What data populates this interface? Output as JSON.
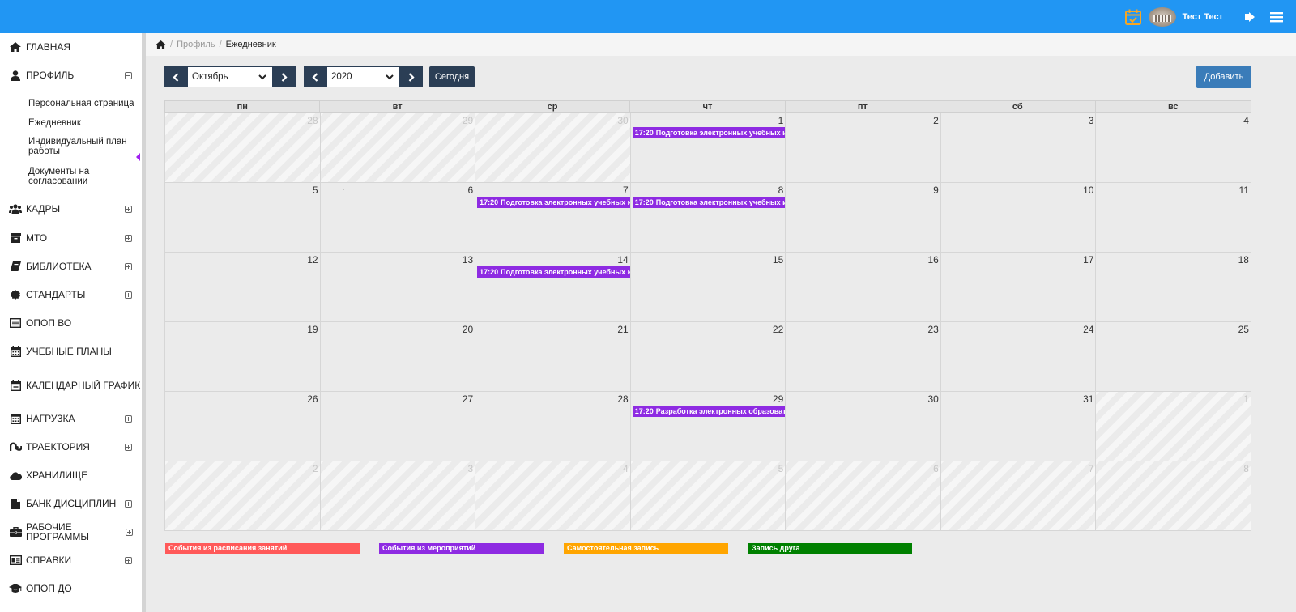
{
  "header": {
    "user_name": "Тест Тест",
    "bar_color": "#2196f3",
    "icons": [
      "calendar-check-icon",
      "avatar",
      "logout-icon",
      "menu-icon"
    ]
  },
  "sidebar": {
    "items": [
      {
        "label": "ГЛАВНАЯ",
        "icon": "home-icon",
        "expandable": false
      },
      {
        "label": "ПРОФИЛЬ",
        "icon": "user-icon",
        "expandable": true,
        "expanded": true
      },
      {
        "label": "КАДРЫ",
        "icon": "users-icon",
        "expandable": true
      },
      {
        "label": "МТО",
        "icon": "archive-icon",
        "expandable": true
      },
      {
        "label": "БИБЛИОТЕКА",
        "icon": "book-icon",
        "expandable": true
      },
      {
        "label": "СТАНДАРТЫ",
        "icon": "certificate-icon",
        "expandable": true
      },
      {
        "label": "ОПОП ВО",
        "icon": "list-alt-icon",
        "expandable": false
      },
      {
        "label": "УЧЕБНЫЕ ПЛАНЫ",
        "icon": "calendar-icon",
        "expandable": false
      },
      {
        "label": "КАЛЕНДАРНЫЙ ГРАФИК",
        "icon": "calendar-minus-icon",
        "expandable": false
      },
      {
        "label": "НАГРУЗКА",
        "icon": "calculator-icon",
        "expandable": true
      },
      {
        "label": "ТРАЕКТОРИЯ",
        "icon": "stumbleupon-icon",
        "expandable": true
      },
      {
        "label": "ХРАНИЛИЩЕ",
        "icon": "cloud-icon",
        "expandable": false
      },
      {
        "label": "БАНК ДИСЦИПЛИН",
        "icon": "file-icon",
        "expandable": true
      },
      {
        "label": "РАБОЧИЕ ПРОГРАММЫ",
        "icon": "briefcase-icon",
        "expandable": true
      },
      {
        "label": "СПРАВКИ",
        "icon": "id-card-icon",
        "expandable": true
      },
      {
        "label": "ОПОП ДО",
        "icon": "graduation-cap-icon",
        "expandable": false
      }
    ],
    "profile_subitems": [
      "Персональная страница",
      "Ежедневник",
      "Индивидуальный план работы",
      "Документы на согласовании"
    ],
    "active_subitem": "Ежедневник"
  },
  "breadcrumb": {
    "items": [
      "Профиль",
      "Ежедневник"
    ]
  },
  "toolbar": {
    "month": "Октябрь",
    "year": "2020",
    "today_label": "Сегодня",
    "add_label": "Добавить"
  },
  "calendar": {
    "weekdays": [
      "пн",
      "вт",
      "ср",
      "чт",
      "пт",
      "сб",
      "вс"
    ],
    "weeks": [
      [
        {
          "d": "28",
          "other": true
        },
        {
          "d": "29",
          "other": true
        },
        {
          "d": "30",
          "other": true
        },
        {
          "d": "1"
        },
        {
          "d": "2"
        },
        {
          "d": "3"
        },
        {
          "d": "4"
        }
      ],
      [
        {
          "d": "5"
        },
        {
          "d": "6"
        },
        {
          "d": "7"
        },
        {
          "d": "8"
        },
        {
          "d": "9"
        },
        {
          "d": "10"
        },
        {
          "d": "11"
        }
      ],
      [
        {
          "d": "12"
        },
        {
          "d": "13"
        },
        {
          "d": "14"
        },
        {
          "d": "15"
        },
        {
          "d": "16"
        },
        {
          "d": "17"
        },
        {
          "d": "18"
        }
      ],
      [
        {
          "d": "19"
        },
        {
          "d": "20"
        },
        {
          "d": "21"
        },
        {
          "d": "22"
        },
        {
          "d": "23"
        },
        {
          "d": "24"
        },
        {
          "d": "25"
        }
      ],
      [
        {
          "d": "26"
        },
        {
          "d": "27"
        },
        {
          "d": "28"
        },
        {
          "d": "29"
        },
        {
          "d": "30"
        },
        {
          "d": "31"
        },
        {
          "d": "1",
          "other": true
        }
      ],
      [
        {
          "d": "2",
          "other": true
        },
        {
          "d": "3",
          "other": true
        },
        {
          "d": "4",
          "other": true
        },
        {
          "d": "5",
          "other": true
        },
        {
          "d": "6",
          "other": true
        },
        {
          "d": "7",
          "other": true
        },
        {
          "d": "8",
          "other": true
        }
      ]
    ],
    "events": [
      {
        "week": 0,
        "day": 3,
        "time": "17:20",
        "title": "Подготовка электронных учебных изд",
        "color": "#8e2be2"
      },
      {
        "week": 1,
        "day": 2,
        "time": "17:20",
        "title": "Подготовка электронных учебных изд",
        "color": "#8e2be2"
      },
      {
        "week": 1,
        "day": 3,
        "time": "17:20",
        "title": "Подготовка электронных учебных изд",
        "color": "#8e2be2"
      },
      {
        "week": 2,
        "day": 2,
        "time": "17:20",
        "title": "Подготовка электронных учебных изд",
        "color": "#8e2be2"
      },
      {
        "week": 4,
        "day": 3,
        "time": "17:20",
        "title": "Разработка электронных образовател",
        "color": "#8e2be2"
      }
    ]
  },
  "legend": [
    {
      "label": "События из расписания занятий",
      "color": "#ff5959"
    },
    {
      "label": "События из мероприятий",
      "color": "#8e2be2"
    },
    {
      "label": "Самостоятельная запись",
      "color": "#ffa500"
    },
    {
      "label": "Запись друга",
      "color": "#008000"
    }
  ]
}
